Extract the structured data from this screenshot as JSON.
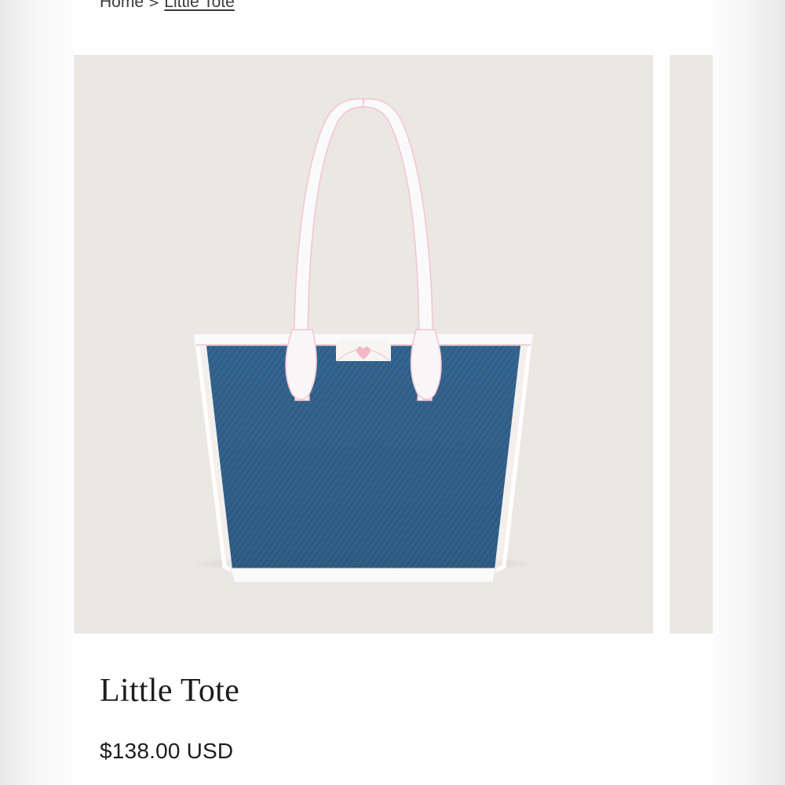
{
  "breadcrumb": {
    "home": "Home",
    "separator": ">",
    "current": "Little Tote"
  },
  "gallery": {
    "main_image_alt": "Little Tote",
    "main_image_icon": "denim-tote-bag-image",
    "background_color": "#ebe7e3"
  },
  "product": {
    "title": "Little Tote",
    "price": "$138.00 USD"
  }
}
